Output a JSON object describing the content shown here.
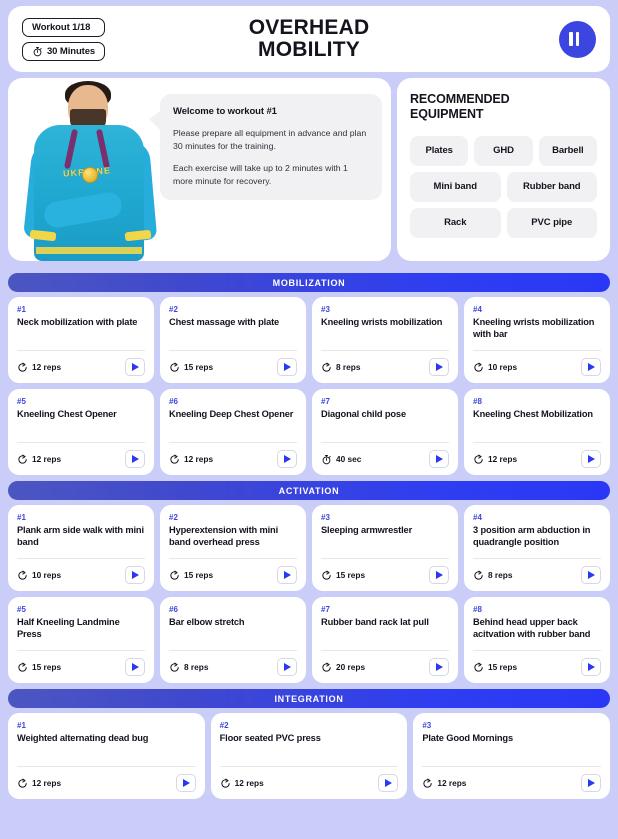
{
  "header": {
    "workout_badge": "Workout 1/18",
    "duration_badge": "30 Minutes",
    "duration_icon": "stopwatch-icon",
    "title_line1": "OVERHEAD",
    "title_line2": "MOBILITY",
    "logo_icon": "barbell-logo-icon",
    "accent_color": "#2a38f5"
  },
  "welcome": {
    "athlete_alt": "weightlifter-photo",
    "athlete_jersey_text": "UKRAINE",
    "bubble_title": "Welcome to workout #1",
    "bubble_p1": "Please prepare all equipment in advance and plan 30 minutes for the training.",
    "bubble_p2": "Each exercise will take up to 2 minutes with 1 more minute for recovery."
  },
  "equipment": {
    "title_line1": "RECOMMENDED",
    "title_line2": "EQUIPMENT",
    "rows": [
      [
        "Plates",
        "GHD",
        "Barbell"
      ],
      [
        "Mini band",
        "Rubber band"
      ],
      [
        "Rack",
        "PVC pipe"
      ]
    ]
  },
  "sections": [
    {
      "label": "MOBILIZATION",
      "columns": 4,
      "exercises": [
        {
          "num": "#1",
          "name": "Neck mobilization with plate",
          "metric": "12 reps",
          "metric_icon": "repeat-icon",
          "play": "play-icon"
        },
        {
          "num": "#2",
          "name": "Chest massage with plate",
          "metric": "15 reps",
          "metric_icon": "repeat-icon",
          "play": "play-icon"
        },
        {
          "num": "#3",
          "name": "Kneeling wrists mobilization",
          "metric": "8 reps",
          "metric_icon": "repeat-icon",
          "play": "play-icon"
        },
        {
          "num": "#4",
          "name": "Kneeling wrists mobilization with bar",
          "metric": "10 reps",
          "metric_icon": "repeat-icon",
          "play": "play-icon"
        },
        {
          "num": "#5",
          "name": "Kneeling Chest Opener",
          "metric": "12 reps",
          "metric_icon": "repeat-icon",
          "play": "play-icon"
        },
        {
          "num": "#6",
          "name": "Kneeling Deep Chest Opener",
          "metric": "12 reps",
          "metric_icon": "repeat-icon",
          "play": "play-icon"
        },
        {
          "num": "#7",
          "name": "Diagonal child pose",
          "metric": "40 sec",
          "metric_icon": "stopwatch-icon",
          "play": "play-icon"
        },
        {
          "num": "#8",
          "name": "Kneeling Chest Mobilization",
          "metric": "12 reps",
          "metric_icon": "repeat-icon",
          "play": "play-icon"
        }
      ]
    },
    {
      "label": "ACTIVATION",
      "columns": 4,
      "exercises": [
        {
          "num": "#1",
          "name": "Plank arm side walk with mini band",
          "metric": "10 reps",
          "metric_icon": "repeat-icon",
          "play": "play-icon"
        },
        {
          "num": "#2",
          "name": "Hyperextension with mini band overhead press",
          "metric": "15 reps",
          "metric_icon": "repeat-icon",
          "play": "play-icon"
        },
        {
          "num": "#3",
          "name": "Sleeping armwrestler",
          "metric": "15 reps",
          "metric_icon": "repeat-icon",
          "play": "play-icon"
        },
        {
          "num": "#4",
          "name": "3 position arm abduction in quadrangle position",
          "metric": "8 reps",
          "metric_icon": "repeat-icon",
          "play": "play-icon"
        },
        {
          "num": "#5",
          "name": "Half Kneeling Landmine Press",
          "metric": "15 reps",
          "metric_icon": "repeat-icon",
          "play": "play-icon"
        },
        {
          "num": "#6",
          "name": "Bar elbow stretch",
          "metric": "8 reps",
          "metric_icon": "repeat-icon",
          "play": "play-icon"
        },
        {
          "num": "#7",
          "name": "Rubber band rack lat pull",
          "metric": "20 reps",
          "metric_icon": "repeat-icon",
          "play": "play-icon"
        },
        {
          "num": "#8",
          "name": "Behind head upper back acitvation with rubber band",
          "metric": "15 reps",
          "metric_icon": "repeat-icon",
          "play": "play-icon"
        }
      ]
    },
    {
      "label": "INTEGRATION",
      "columns": 3,
      "exercises": [
        {
          "num": "#1",
          "name": "Weighted alternating dead bug",
          "metric": "12 reps",
          "metric_icon": "repeat-icon",
          "play": "play-icon"
        },
        {
          "num": "#2",
          "name": "Floor seated PVC press",
          "metric": "12 reps",
          "metric_icon": "repeat-icon",
          "play": "play-icon"
        },
        {
          "num": "#3",
          "name": "Plate Good Mornings",
          "metric": "12 reps",
          "metric_icon": "repeat-icon",
          "play": "play-icon"
        }
      ]
    }
  ]
}
